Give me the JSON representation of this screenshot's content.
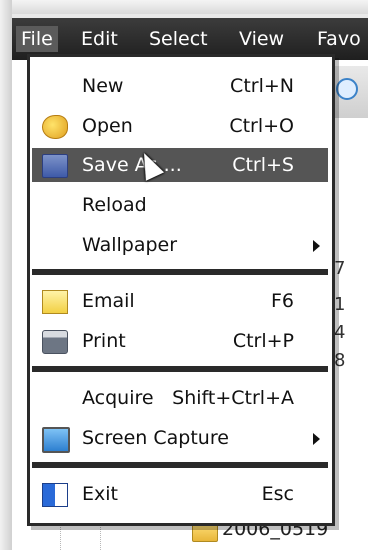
{
  "menubar": {
    "items": [
      {
        "label": "File"
      },
      {
        "label": "Edit"
      },
      {
        "label": "Select"
      },
      {
        "label": "View"
      },
      {
        "label": "Favo"
      }
    ]
  },
  "background": {
    "peek_digits": [
      "7",
      "1",
      "4",
      "8"
    ],
    "folder_name": "2006_0519"
  },
  "file_menu": {
    "items": [
      {
        "label": "New",
        "shortcut": "Ctrl+N",
        "icon": "none"
      },
      {
        "label": "Open",
        "shortcut": "Ctrl+O",
        "icon": "open-folder-icon"
      },
      {
        "label": "Save As ...",
        "shortcut": "Ctrl+S",
        "icon": "save-disk-icon",
        "highlighted": true
      },
      {
        "label": "Reload",
        "shortcut": "",
        "icon": "none"
      },
      {
        "label": "Wallpaper",
        "shortcut": "",
        "icon": "none",
        "submenu": true
      },
      {
        "label": "Email",
        "shortcut": "F6",
        "icon": "email-icon"
      },
      {
        "label": "Print",
        "shortcut": "Ctrl+P",
        "icon": "printer-icon"
      },
      {
        "label": "Acquire",
        "shortcut": "Shift+Ctrl+A",
        "icon": "none"
      },
      {
        "label": "Screen Capture",
        "shortcut": "",
        "icon": "screen-icon",
        "submenu": true
      },
      {
        "label": "Exit",
        "shortcut": "Esc",
        "icon": "exit-icon"
      }
    ]
  },
  "colors": {
    "menubar_bg": "#2a2a2a",
    "highlight_bg": "#555555",
    "menu_border": "#2a2a2a"
  }
}
